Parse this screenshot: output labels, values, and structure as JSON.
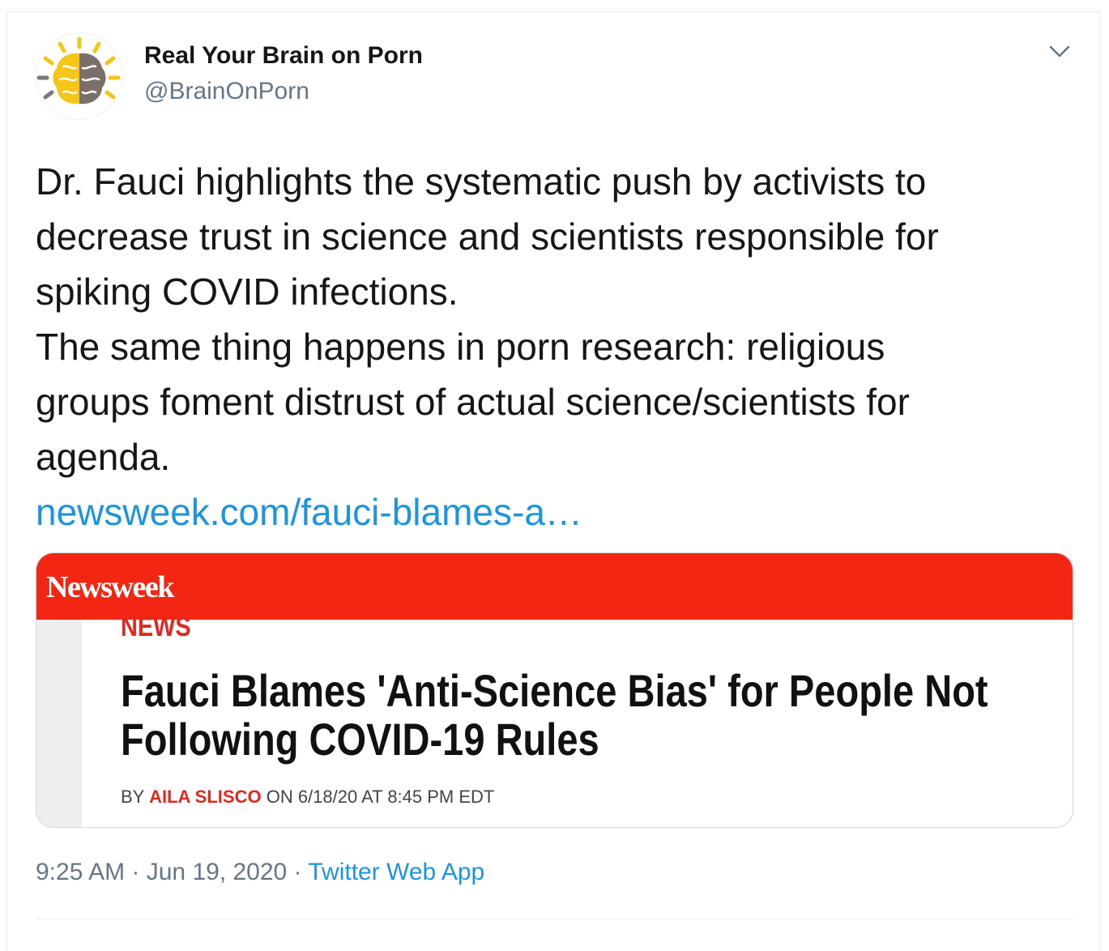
{
  "author": {
    "display_name": "Real Your Brain on Porn",
    "handle": "@BrainOnPorn",
    "avatar_icon": "brain-sun-logo-icon"
  },
  "tweet": {
    "paragraphs": [
      "Dr. Fauci highlights the systematic push by activists to",
      "decrease trust in science and scientists responsible for",
      "spiking COVID infections.",
      "The same thing happens in porn research: religious",
      "groups foment distrust of actual science/scientists for",
      "agenda."
    ],
    "link_text": "newsweek.com/fauci-blames-a…"
  },
  "card": {
    "publisher": "Newsweek",
    "section": "NEWS",
    "headline_line1": "Fauci Blames 'Anti-Science Bias' for People Not",
    "headline_line2": "Following COVID-19 Rules",
    "byline_prefix": "BY ",
    "byline_author": "AILA SLISCO",
    "byline_suffix": " ON 6/18/20 AT 8:45 PM EDT"
  },
  "meta": {
    "time": "9:25 AM",
    "separator": " · ",
    "date": "Jun 19, 2020",
    "app": "Twitter Web App"
  },
  "colors": {
    "link_blue": "#1b95e0",
    "newsweek_red": "#f22613",
    "secondary_text": "#657786"
  }
}
